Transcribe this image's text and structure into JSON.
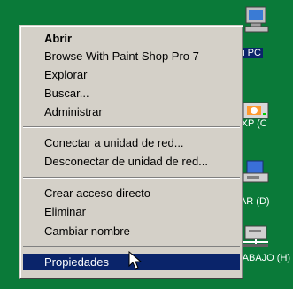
{
  "menu": {
    "items": [
      {
        "label": "Abrir",
        "bold": true
      },
      {
        "label": "Browse With Paint Shop Pro 7"
      },
      {
        "label": "Explorar"
      },
      {
        "label": "Buscar..."
      },
      {
        "label": "Administrar"
      },
      {
        "label": "Conectar a unidad de red..."
      },
      {
        "label": "Desconectar de unidad de red..."
      },
      {
        "label": "Crear acceso directo"
      },
      {
        "label": "Eliminar"
      },
      {
        "label": "Cambiar nombre"
      },
      {
        "label": "Propiedades",
        "selected": true
      }
    ]
  },
  "desktop": {
    "icons": [
      {
        "label": "Mi PC",
        "icon": "my-computer-icon"
      },
      {
        "label": "in XP (C",
        "icon": "hard-drive-icon"
      },
      {
        "label": "RAR (D)",
        "icon": "network-drive-icon"
      },
      {
        "label": "TRABAJO (H)",
        "icon": "network-drive-icon"
      }
    ]
  },
  "colors": {
    "desktop_bg": "#0a7a39",
    "menu_bg": "#d4d0c8",
    "selection": "#0a246a"
  }
}
